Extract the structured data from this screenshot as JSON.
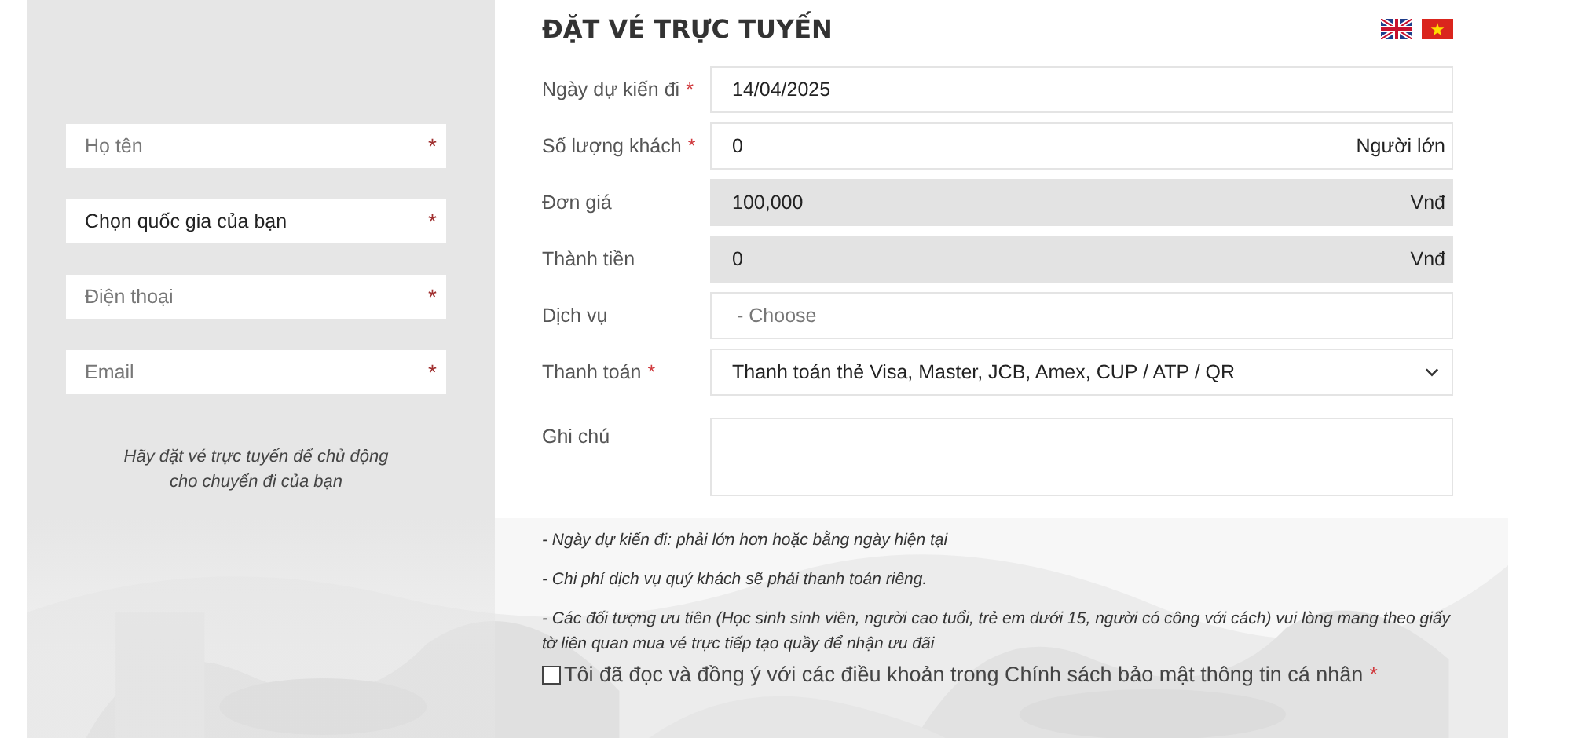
{
  "contact_panel": {
    "fields": [
      {
        "kind": "input",
        "placeholder": "Họ tên",
        "required_mark": "*"
      },
      {
        "kind": "select",
        "value": "Chọn quốc gia của bạn",
        "required_mark": "*"
      },
      {
        "kind": "input",
        "placeholder": "Điện thoại",
        "required_mark": "*"
      },
      {
        "kind": "input",
        "placeholder": "Email",
        "required_mark": "*"
      }
    ],
    "note": "Hãy đặt vé trực tuyến để chủ động cho chuyển đi của bạn"
  },
  "booking": {
    "title": "ĐẶT VÉ TRỰC TUYẾN",
    "languages": [
      {
        "kind": "uk"
      },
      {
        "kind": "vn"
      }
    ],
    "fields": [
      {
        "label": "Ngày dự kiến đi",
        "required_mark": "*",
        "kind": "input",
        "value": "14/04/2025"
      },
      {
        "label": "Số lượng khách",
        "required_mark": "*",
        "kind": "input",
        "value": "0",
        "unit": "Người lớn"
      },
      {
        "label": "Đơn giá",
        "kind": "readonly",
        "value": "100,000",
        "unit": "Vnđ"
      },
      {
        "label": "Thành tiền",
        "kind": "readonly",
        "value": "0",
        "unit": "Vnđ"
      },
      {
        "label": "Dịch vụ",
        "kind": "input",
        "placeholder": "- Choose"
      },
      {
        "label": "Thanh toán",
        "required_mark": "*",
        "kind": "select",
        "value": "Thanh toán thẻ Visa, Master, JCB, Amex, CUP / ATP / QR"
      },
      {
        "label": "Ghi chú",
        "kind": "textarea"
      }
    ],
    "notes": [
      "- Ngày dự kiến đi: phải lớn hơn hoặc bằng ngày hiện tại",
      "- Chi phí dịch vụ quý khách sẽ phải thanh toán riêng.",
      "- Các đối tượng ưu tiên (Học sinh sinh viên, người cao tuổi, trẻ em dưới 15, người có công với cách) vui lòng mang theo giấy tờ liên quan mua vé trực tiếp tạo quầy để nhận ưu đãi"
    ],
    "agreement": {
      "label": "Tôi đã đọc và đồng ý với các điều khoản trong Chính sách bảo mật thông tin cá nhân",
      "checked": false,
      "required_mark": "*"
    }
  }
}
